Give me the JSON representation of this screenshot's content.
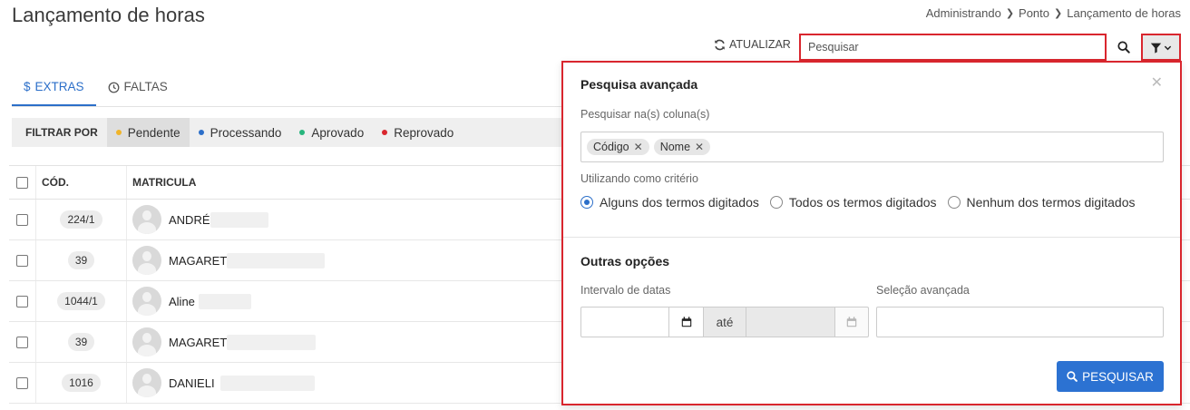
{
  "page": {
    "title": "Lançamento de horas",
    "breadcrumb": [
      "Administrando",
      "Ponto",
      "Lançamento de horas"
    ]
  },
  "toolbar": {
    "refresh_label": "ATUALIZAR",
    "search_placeholder": "Pesquisar"
  },
  "tabs": [
    {
      "label": "EXTRAS",
      "icon": "dollar-icon",
      "active": true
    },
    {
      "label": "FALTAS",
      "icon": "clock-icon",
      "active": false
    }
  ],
  "filter": {
    "label": "FILTRAR POR",
    "options": [
      {
        "label": "Pendente",
        "color": "#f0b429",
        "active": true
      },
      {
        "label": "Processando",
        "color": "#2c6fc9",
        "active": false
      },
      {
        "label": "Aprovado",
        "color": "#27b57d",
        "active": false
      },
      {
        "label": "Reprovado",
        "color": "#d9262e",
        "active": false
      }
    ]
  },
  "table": {
    "headers": {
      "cod": "CÓD.",
      "matricula": "MATRICULA"
    },
    "rows": [
      {
        "cod": "224/1",
        "name": "ANDRÉ"
      },
      {
        "cod": "39",
        "name": "MAGARET"
      },
      {
        "cod": "1044/1",
        "name": "Aline"
      },
      {
        "cod": "39",
        "name": "MAGARET"
      },
      {
        "cod": "1016",
        "name": "DANIELI"
      }
    ]
  },
  "panel": {
    "title": "Pesquisa avançada",
    "columns_label": "Pesquisar na(s) coluna(s)",
    "tags": [
      "Código",
      "Nome"
    ],
    "criteria_label": "Utilizando como critério",
    "criteria": [
      {
        "label": "Alguns dos termos digitados",
        "checked": true
      },
      {
        "label": "Todos os termos digitados",
        "checked": false
      },
      {
        "label": "Nenhum dos termos digitados",
        "checked": false
      }
    ],
    "other_title": "Outras opções",
    "date_label": "Intervalo de datas",
    "date_between": "até",
    "advanced_label": "Seleção avançada",
    "submit_label": "PESQUISAR"
  },
  "colors": {
    "accent": "#2c6fc9",
    "highlight": "#d9262e",
    "primary_button": "#2c72d2"
  }
}
